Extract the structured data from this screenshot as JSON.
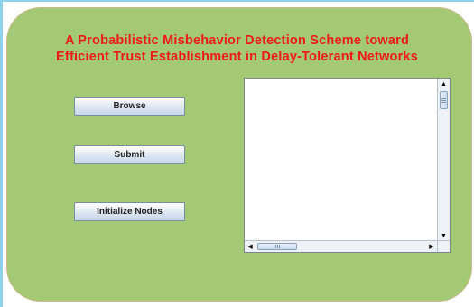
{
  "header": {
    "title_line1": "A Probabilistic Misbehavior Detection Scheme toward",
    "title_line2": "Efficient Trust Establishment in Delay-Tolerant Networks"
  },
  "buttons": {
    "browse": "Browse",
    "submit": "Submit",
    "initialize": "Initialize Nodes"
  },
  "output_area": {
    "text": ""
  },
  "colors": {
    "panel_bg": "#a3c974",
    "title": "#f01818",
    "frame": "#8fd1ea"
  },
  "icons": {
    "scroll_up": "arrow-up-icon",
    "scroll_down": "arrow-down-icon",
    "scroll_left": "arrow-left-icon",
    "scroll_right": "arrow-right-icon"
  }
}
